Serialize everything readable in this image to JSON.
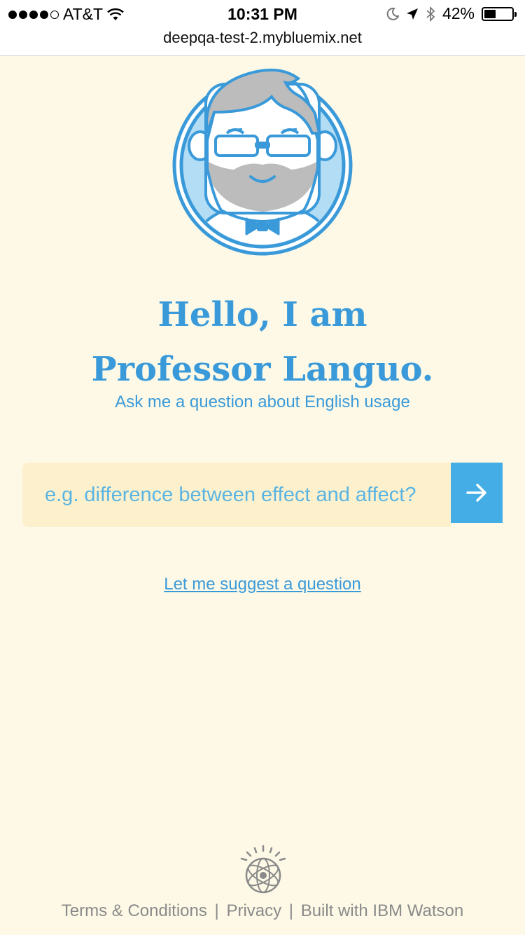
{
  "status_bar": {
    "carrier": "AT&T",
    "time": "10:31 PM",
    "battery_percent": "42%",
    "battery_level": 0.42,
    "signal_bars": 4,
    "icons": [
      "wifi-icon",
      "moon-icon",
      "location-arrow-icon",
      "bluetooth-icon",
      "battery-icon"
    ]
  },
  "browser": {
    "url": "deepqa-test-2.mybluemix.net"
  },
  "hero": {
    "title": "Hello, I am Professor Languo.",
    "subtitle": "Ask me a question about English usage"
  },
  "search": {
    "placeholder": "e.g. difference between effect and affect?",
    "submit_icon": "arrow-right-icon"
  },
  "suggest": {
    "link_text": "Let me suggest a question"
  },
  "footer": {
    "links": [
      "Terms & Conditions",
      "Privacy",
      "Built with IBM Watson"
    ],
    "separator": "|"
  },
  "colors": {
    "background": "#fdf9e6",
    "accent": "#3a9ad9",
    "button": "#45ade6",
    "input_bg": "#fdf1cd",
    "footer_text": "#8a8a8a"
  }
}
